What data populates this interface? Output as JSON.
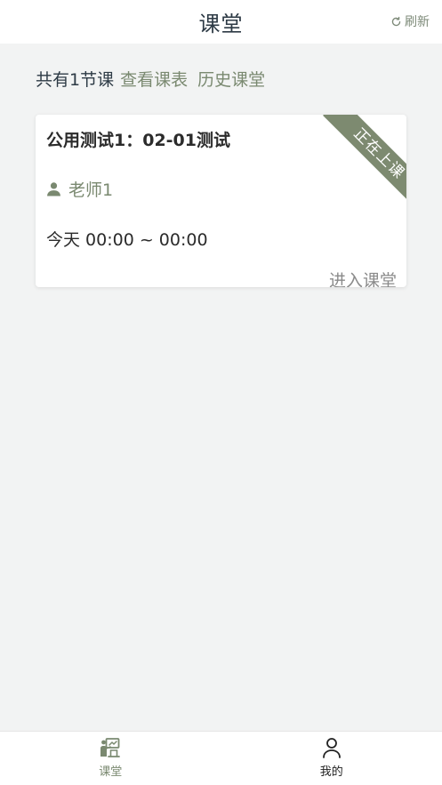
{
  "header": {
    "title": "课堂",
    "refresh_label": "刷新"
  },
  "summary": {
    "count_text": "共有1节课",
    "schedule_link": "查看课表",
    "history_link": "历史课堂"
  },
  "courses": [
    {
      "title": "公用测试1：02-01测试",
      "teacher": "老师1",
      "time": "今天 00:00 ~ 00:00",
      "status": "正在上课",
      "enter_label": "进入课堂"
    }
  ],
  "bottom_nav": {
    "items": [
      {
        "label": "课堂",
        "icon": "classroom-icon",
        "active": true
      },
      {
        "label": "我的",
        "icon": "person-icon",
        "active": false
      }
    ]
  },
  "colors": {
    "accent": "#7a8970",
    "ribbon": "#7d8a70",
    "background": "#f2f3f3"
  }
}
